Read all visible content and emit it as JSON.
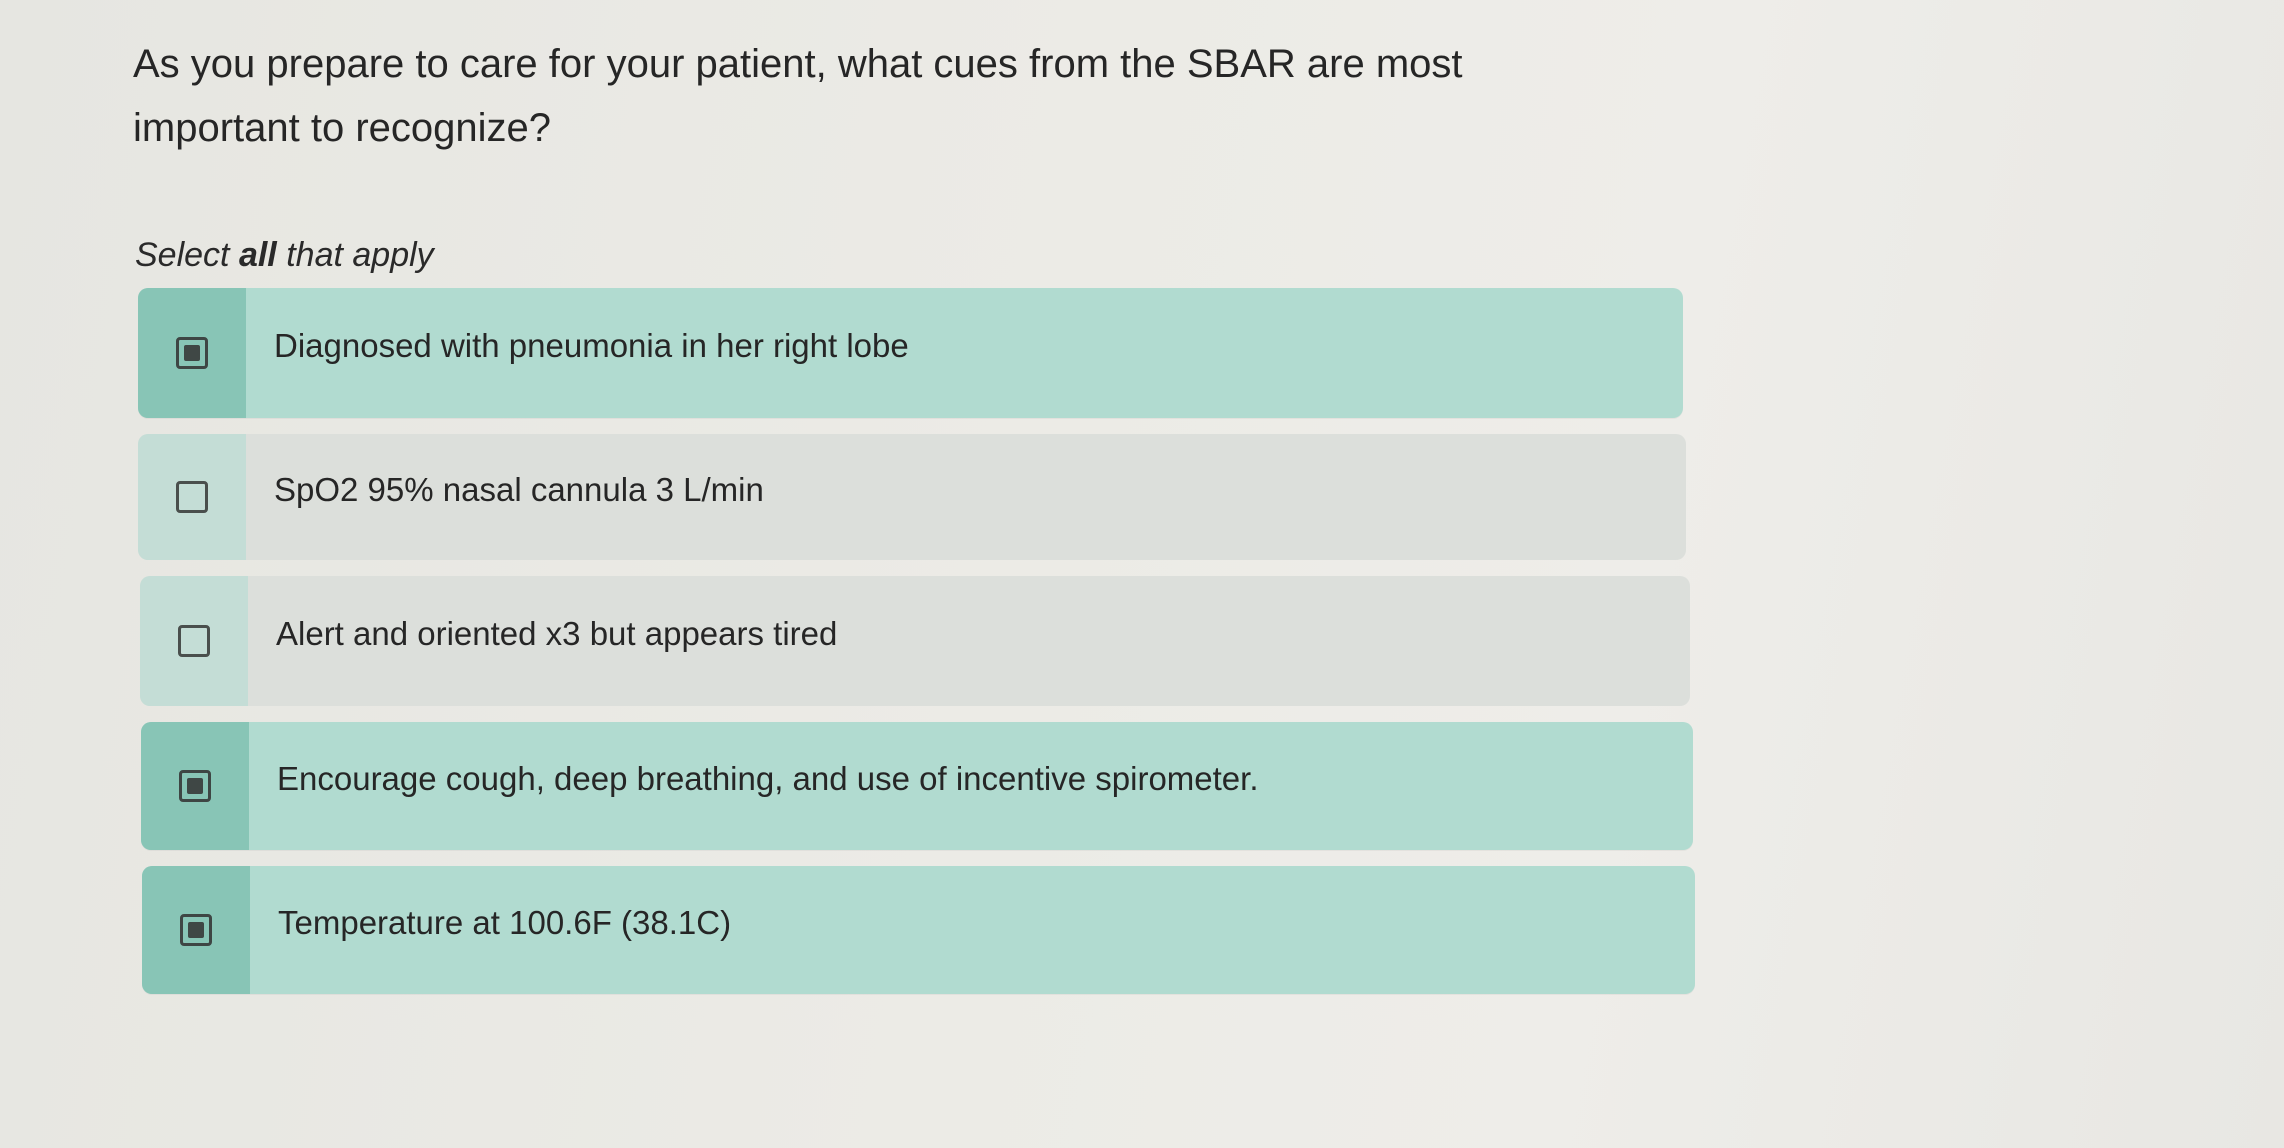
{
  "question": {
    "text": "As you prepare to care for your patient, what cues from the SBAR are most important to recognize?"
  },
  "instruction": {
    "prefix": "Select ",
    "emphasis": "all",
    "suffix": " that apply"
  },
  "options": [
    {
      "label": "Diagnosed with pneumonia in her right lobe",
      "checked": true
    },
    {
      "label": "SpO2 95% nasal cannula 3 L/min",
      "checked": false
    },
    {
      "label": "Alert and oriented x3 but appears tired",
      "checked": false
    },
    {
      "label": "Encourage cough, deep breathing, and use of incentive spirometer.",
      "checked": true
    },
    {
      "label": "Temperature at 100.6F (38.1C)",
      "checked": true
    }
  ],
  "colors": {
    "selected_row": "#b1dbd0",
    "selected_checkbox_cell": "#88c5b6",
    "unselected_row": "#dcdfdb",
    "unselected_checkbox_cell": "#c4ddd6"
  }
}
